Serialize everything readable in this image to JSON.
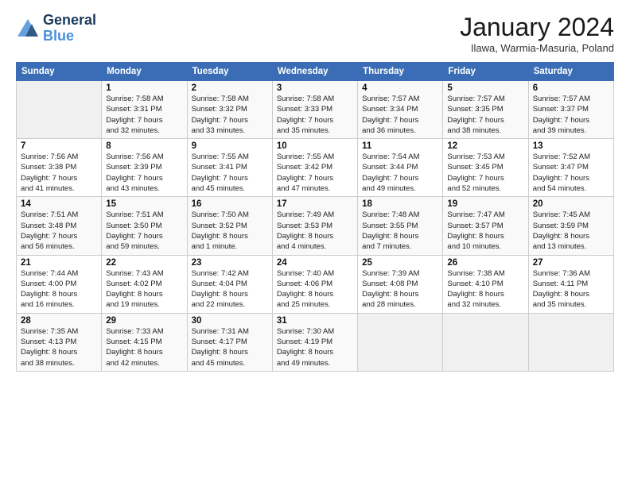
{
  "header": {
    "logo_line1": "General",
    "logo_line2": "Blue",
    "title": "January 2024",
    "subtitle": "Ilawa, Warmia-Masuria, Poland"
  },
  "days_of_week": [
    "Sunday",
    "Monday",
    "Tuesday",
    "Wednesday",
    "Thursday",
    "Friday",
    "Saturday"
  ],
  "weeks": [
    [
      {
        "day": "",
        "detail": ""
      },
      {
        "day": "1",
        "detail": "Sunrise: 7:58 AM\nSunset: 3:31 PM\nDaylight: 7 hours\nand 32 minutes."
      },
      {
        "day": "2",
        "detail": "Sunrise: 7:58 AM\nSunset: 3:32 PM\nDaylight: 7 hours\nand 33 minutes."
      },
      {
        "day": "3",
        "detail": "Sunrise: 7:58 AM\nSunset: 3:33 PM\nDaylight: 7 hours\nand 35 minutes."
      },
      {
        "day": "4",
        "detail": "Sunrise: 7:57 AM\nSunset: 3:34 PM\nDaylight: 7 hours\nand 36 minutes."
      },
      {
        "day": "5",
        "detail": "Sunrise: 7:57 AM\nSunset: 3:35 PM\nDaylight: 7 hours\nand 38 minutes."
      },
      {
        "day": "6",
        "detail": "Sunrise: 7:57 AM\nSunset: 3:37 PM\nDaylight: 7 hours\nand 39 minutes."
      }
    ],
    [
      {
        "day": "7",
        "detail": "Sunrise: 7:56 AM\nSunset: 3:38 PM\nDaylight: 7 hours\nand 41 minutes."
      },
      {
        "day": "8",
        "detail": "Sunrise: 7:56 AM\nSunset: 3:39 PM\nDaylight: 7 hours\nand 43 minutes."
      },
      {
        "day": "9",
        "detail": "Sunrise: 7:55 AM\nSunset: 3:41 PM\nDaylight: 7 hours\nand 45 minutes."
      },
      {
        "day": "10",
        "detail": "Sunrise: 7:55 AM\nSunset: 3:42 PM\nDaylight: 7 hours\nand 47 minutes."
      },
      {
        "day": "11",
        "detail": "Sunrise: 7:54 AM\nSunset: 3:44 PM\nDaylight: 7 hours\nand 49 minutes."
      },
      {
        "day": "12",
        "detail": "Sunrise: 7:53 AM\nSunset: 3:45 PM\nDaylight: 7 hours\nand 52 minutes."
      },
      {
        "day": "13",
        "detail": "Sunrise: 7:52 AM\nSunset: 3:47 PM\nDaylight: 7 hours\nand 54 minutes."
      }
    ],
    [
      {
        "day": "14",
        "detail": "Sunrise: 7:51 AM\nSunset: 3:48 PM\nDaylight: 7 hours\nand 56 minutes."
      },
      {
        "day": "15",
        "detail": "Sunrise: 7:51 AM\nSunset: 3:50 PM\nDaylight: 7 hours\nand 59 minutes."
      },
      {
        "day": "16",
        "detail": "Sunrise: 7:50 AM\nSunset: 3:52 PM\nDaylight: 8 hours\nand 1 minute."
      },
      {
        "day": "17",
        "detail": "Sunrise: 7:49 AM\nSunset: 3:53 PM\nDaylight: 8 hours\nand 4 minutes."
      },
      {
        "day": "18",
        "detail": "Sunrise: 7:48 AM\nSunset: 3:55 PM\nDaylight: 8 hours\nand 7 minutes."
      },
      {
        "day": "19",
        "detail": "Sunrise: 7:47 AM\nSunset: 3:57 PM\nDaylight: 8 hours\nand 10 minutes."
      },
      {
        "day": "20",
        "detail": "Sunrise: 7:45 AM\nSunset: 3:59 PM\nDaylight: 8 hours\nand 13 minutes."
      }
    ],
    [
      {
        "day": "21",
        "detail": "Sunrise: 7:44 AM\nSunset: 4:00 PM\nDaylight: 8 hours\nand 16 minutes."
      },
      {
        "day": "22",
        "detail": "Sunrise: 7:43 AM\nSunset: 4:02 PM\nDaylight: 8 hours\nand 19 minutes."
      },
      {
        "day": "23",
        "detail": "Sunrise: 7:42 AM\nSunset: 4:04 PM\nDaylight: 8 hours\nand 22 minutes."
      },
      {
        "day": "24",
        "detail": "Sunrise: 7:40 AM\nSunset: 4:06 PM\nDaylight: 8 hours\nand 25 minutes."
      },
      {
        "day": "25",
        "detail": "Sunrise: 7:39 AM\nSunset: 4:08 PM\nDaylight: 8 hours\nand 28 minutes."
      },
      {
        "day": "26",
        "detail": "Sunrise: 7:38 AM\nSunset: 4:10 PM\nDaylight: 8 hours\nand 32 minutes."
      },
      {
        "day": "27",
        "detail": "Sunrise: 7:36 AM\nSunset: 4:11 PM\nDaylight: 8 hours\nand 35 minutes."
      }
    ],
    [
      {
        "day": "28",
        "detail": "Sunrise: 7:35 AM\nSunset: 4:13 PM\nDaylight: 8 hours\nand 38 minutes."
      },
      {
        "day": "29",
        "detail": "Sunrise: 7:33 AM\nSunset: 4:15 PM\nDaylight: 8 hours\nand 42 minutes."
      },
      {
        "day": "30",
        "detail": "Sunrise: 7:31 AM\nSunset: 4:17 PM\nDaylight: 8 hours\nand 45 minutes."
      },
      {
        "day": "31",
        "detail": "Sunrise: 7:30 AM\nSunset: 4:19 PM\nDaylight: 8 hours\nand 49 minutes."
      },
      {
        "day": "",
        "detail": ""
      },
      {
        "day": "",
        "detail": ""
      },
      {
        "day": "",
        "detail": ""
      }
    ]
  ]
}
